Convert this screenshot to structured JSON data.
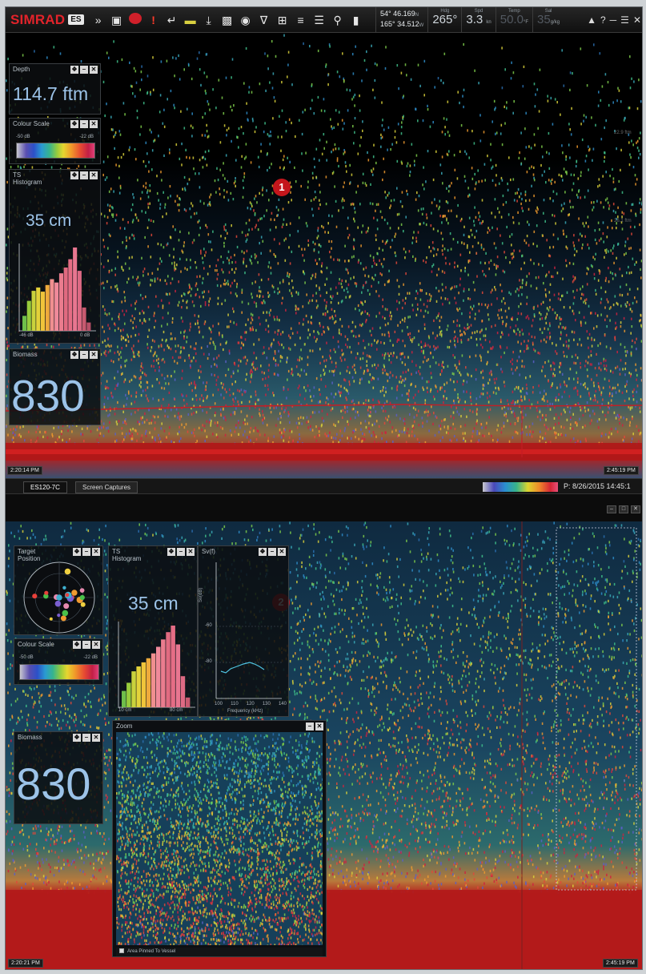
{
  "toolbar": {
    "brand": "SIMRAD",
    "model_badge": "ES",
    "icons": [
      "chevrons-down-icon",
      "camera-icon",
      "record-icon",
      "alert-icon",
      "return-icon",
      "minus-icon",
      "download-icon",
      "bars-icon",
      "globe-icon",
      "filter-icon",
      "grid-icon",
      "layers-icon",
      "list-icon",
      "magnifier-icon",
      "battery-icon",
      "warning-icon",
      "help-icon",
      "minimize-icon",
      "menu-icon",
      "close-icon"
    ],
    "position": {
      "lat": "54° 46.169",
      "lat_hemi": "N",
      "lon": "165° 34.512",
      "lon_hemi": "W"
    },
    "heading": {
      "label": "Hdg",
      "value": "265°"
    },
    "speed": {
      "label": "Spd",
      "value": "3.3",
      "unit": "kn"
    },
    "temp": {
      "label": "Temp",
      "value": "50.0",
      "unit": "°F"
    },
    "salinity": {
      "label": "Sal",
      "value": "35",
      "unit": "g/kg"
    },
    "help": "?"
  },
  "pane1": {
    "callout": "1",
    "depth_widget": {
      "title": "Depth",
      "value": "114.7 ftm"
    },
    "colour_scale": {
      "title": "Colour Scale",
      "min": "-50 dB",
      "max": "-22 dB"
    },
    "ts_histogram": {
      "title": "TS\nHistogram",
      "value": "35 cm",
      "xmin": "-46 dB",
      "xmax": "0 dB",
      "bars": [
        0.18,
        0.36,
        0.48,
        0.52,
        0.47,
        0.55,
        0.62,
        0.58,
        0.69,
        0.76,
        0.86,
        1.0,
        0.72,
        0.28,
        0.1
      ]
    },
    "biomass": {
      "title": "Biomass",
      "value": "830"
    },
    "time_start": "2:20:14 PM",
    "time_end": "2:45:19 PM",
    "range_ticks": [
      "22.9 ftm",
      "26.1 ftm"
    ]
  },
  "statusbar": {
    "tabs": [
      "ES120-7C",
      "Screen Captures"
    ],
    "text": "P: 8/26/2015  14:45:1"
  },
  "pane2": {
    "callout": "2",
    "target_position": {
      "title": "Target\nPosition"
    },
    "colour_scale": {
      "title": "Colour Scale",
      "min": "-50 dB",
      "max": "-22 dB"
    },
    "ts_histogram": {
      "title": "TS\nHistogram",
      "value": "35 cm",
      "xmin": "10 cm",
      "xmax": "80 cm",
      "bars": [
        0.2,
        0.3,
        0.44,
        0.5,
        0.55,
        0.6,
        0.66,
        0.74,
        0.83,
        0.92,
        1.0,
        0.77,
        0.38,
        0.12
      ]
    },
    "svf": {
      "title": "Sv(f)",
      "ylabel": "Sv(dB)",
      "xlabel": "Frequency (kHz)",
      "xticks": [
        "100",
        "110",
        "120",
        "130",
        "140"
      ],
      "yticks": [
        "-60",
        "-80"
      ]
    },
    "biomass": {
      "title": "Biomass",
      "value": "830"
    },
    "zoom": {
      "title": "Zoom",
      "footer": "Area Pinned To Vessel"
    },
    "time_start": "2:20:21 PM",
    "time_end": "2:45:19 PM"
  }
}
